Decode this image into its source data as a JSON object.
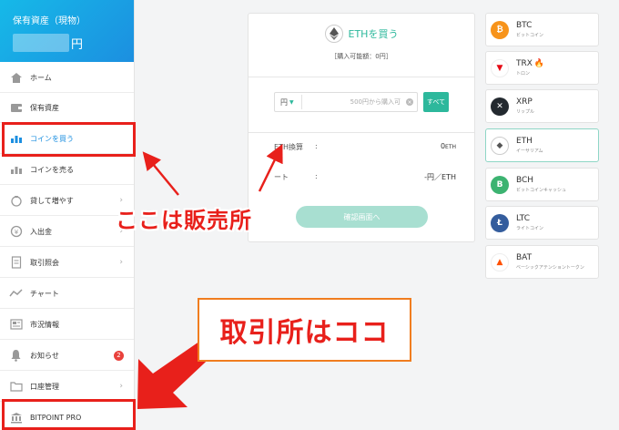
{
  "sidebar": {
    "title": "保有資産（現物）",
    "amount_unit": "円",
    "items": [
      {
        "label": "ホーム",
        "icon": "home-icon"
      },
      {
        "label": "保有資産",
        "icon": "wallet-icon"
      },
      {
        "label": "コインを買う",
        "icon": "buy-coin-icon"
      },
      {
        "label": "コインを売る",
        "icon": "sell-coin-icon"
      },
      {
        "label": "貸して増やす",
        "icon": "lend-icon"
      },
      {
        "label": "入出金",
        "icon": "deposit-icon"
      },
      {
        "label": "取引照会",
        "icon": "document-icon"
      },
      {
        "label": "チャート",
        "icon": "chart-icon"
      },
      {
        "label": "市況情報",
        "icon": "news-icon"
      },
      {
        "label": "お知らせ",
        "icon": "bell-icon",
        "badge": "2"
      },
      {
        "label": "口座管理",
        "icon": "folder-icon"
      },
      {
        "label": "BITPOINT PRO",
        "icon": "bank-icon"
      }
    ]
  },
  "trade": {
    "title": "ETHを買う",
    "available": "［購入可能額：0円］",
    "unit": "円",
    "placeholder": "500円から購入可",
    "all_button": "すべて",
    "eth_label": "ETH換算",
    "colon": ":",
    "eth_value": "0",
    "eth_unit": "ETH",
    "rate_label": "ート",
    "rate_value": "-円／ETH",
    "confirm_button": "確認画面へ"
  },
  "coins": [
    {
      "symbol": "BTC",
      "name": "ビットコイン",
      "color": "#f7931a",
      "glyph": "₿"
    },
    {
      "symbol": "TRX",
      "name": "トロン",
      "color": "#e50914",
      "glyph": "▼",
      "hot": "🔥"
    },
    {
      "symbol": "XRP",
      "name": "リップル",
      "color": "#23292f",
      "glyph": "✕"
    },
    {
      "symbol": "ETH",
      "name": "イーサリアム",
      "color": "#ffffff",
      "glyph": "◆"
    },
    {
      "symbol": "BCH",
      "name": "ビットコインキャッシュ",
      "color": "#3cb371",
      "glyph": "B"
    },
    {
      "symbol": "LTC",
      "name": "ライトコイン",
      "color": "#345d9d",
      "glyph": "Ł"
    },
    {
      "symbol": "BAT",
      "name": "ベーシックアテンショントークン",
      "color": "#ffffff",
      "glyph": "▲"
    }
  ],
  "annotations": {
    "label1": "ここは販売所",
    "label2": "取引所はココ"
  },
  "colors": {
    "accent": "#2db89c",
    "header": "#1c8fe0",
    "annotation": "#e8201b"
  }
}
